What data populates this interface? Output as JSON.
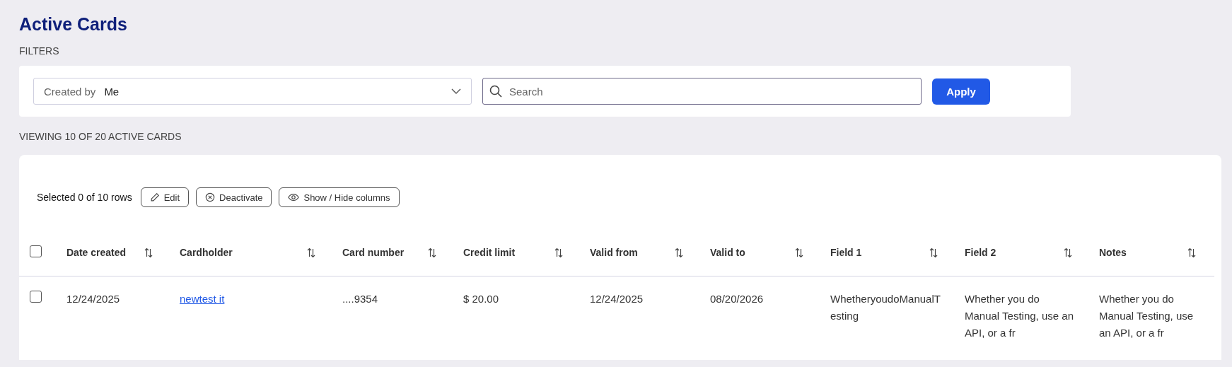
{
  "page": {
    "title": "Active Cards",
    "filters_label": "FILTERS",
    "viewing_label": "VIEWING 10 OF 20 ACTIVE CARDS"
  },
  "filters": {
    "dropdown": {
      "label": "Created by",
      "value": "Me"
    },
    "search": {
      "placeholder": "Search"
    },
    "apply_button": "Apply"
  },
  "toolbar": {
    "selection_text": "Selected 0 of 10 rows",
    "buttons": [
      {
        "kind": "edit",
        "label": "Edit"
      },
      {
        "kind": "deactivate",
        "label": "Deactivate"
      },
      {
        "kind": "columns",
        "label": "Show / Hide columns"
      }
    ]
  },
  "table": {
    "select_all_checked": false,
    "columns": [
      "Date created",
      "Cardholder",
      "Card number",
      "Credit limit",
      "Valid from",
      "Valid to",
      "Field 1",
      "Field 2",
      "Notes"
    ],
    "rows": [
      {
        "checked": false,
        "cells": [
          {
            "kind": "text",
            "text": "12/24/2025"
          },
          {
            "kind": "link",
            "text": "newtest it"
          },
          {
            "kind": "text",
            "text": "....9354"
          },
          {
            "kind": "text",
            "text": "$ 20.00"
          },
          {
            "kind": "text",
            "text": "12/24/2025"
          },
          {
            "kind": "text",
            "text": "08/20/2026"
          },
          {
            "kind": "text",
            "text": "WhetheryoudoManualTesting"
          },
          {
            "kind": "text",
            "text": "Whether you do Manual Testing, use an API, or a fr"
          },
          {
            "kind": "text",
            "text": "Whether you do Manual Testing, use an API, or a fr"
          }
        ]
      }
    ]
  }
}
